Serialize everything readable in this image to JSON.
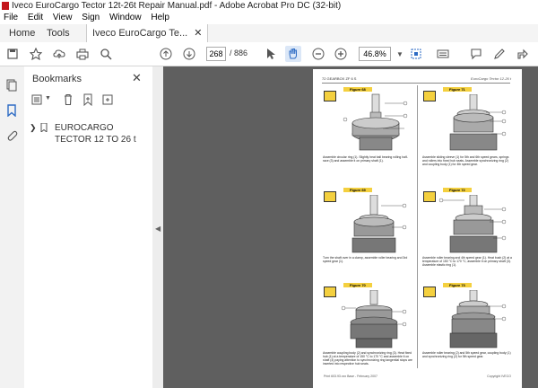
{
  "window": {
    "title": "Iveco EuroCargo Tector 12t-26t Repair Manual.pdf - Adobe Acrobat Pro DC (32-bit)"
  },
  "menu": [
    "File",
    "Edit",
    "View",
    "Sign",
    "Window",
    "Help"
  ],
  "tabs": {
    "home": "Home",
    "tools": "Tools",
    "document": "Iveco EuroCargo Te..."
  },
  "toolbar": {
    "page_current": "268",
    "page_total": "/ 886",
    "zoom": "46.8%"
  },
  "bookmarks": {
    "title": "Bookmarks",
    "item": "EUROCARGO TECTOR 12 TO 26 t"
  },
  "page": {
    "header_left": "72   GEARBOX  ZF 6 S",
    "header_right": "EuroCargo Tector 12-26 t",
    "footer_left": "Print 603.93.xxx   Base - February 2007",
    "footer_right": "Copyright IVECO",
    "figures": [
      {
        "label": "Figure 68",
        "caption": "Assemble circular ring (1). Slightly heat ball bearing rolling half-race (3) and assemble it on primary shaft (1)."
      },
      {
        "label": "Figure 71",
        "caption": "Assemble sliding sleeve (1) for 5th and 6th speed gears, springs and rollers into fixed hub seats. Assemble synchronizing ring (2) and coupling body (1) for 4th speed gear."
      },
      {
        "label": "Figure 69",
        "caption": "Turn the shaft over in a clamp, assemble roller bearing and 3rd speed gear (1)."
      },
      {
        "label": "Figure 72",
        "caption": "Assemble roller bearing and 4th speed gear (1). Heat bush (2) at a temperature of 150 °C to 170 °C, assemble it on primary shaft (3). Assemble elastic ring (1)."
      },
      {
        "label": "Figure 70",
        "caption": "Assemble coupling body (2) and synchronizing ring (3). Heat fixed hub (1) at a temperature of 150 °C to 170 °C and assemble it on shaft (4) paying attention to synchronizing ring tangential stops are inserted into respective hub seats."
      },
      {
        "label": "Figure 73",
        "caption": "Assemble roller bearing (2) and 5th speed gear, coupling body (1) and synchronizing ring (2) for 5th speed gear."
      }
    ]
  },
  "colors": {
    "accent": "#c4161c",
    "figure_tag": "#f4d03f",
    "viewer_bg": "#5f5f5f"
  }
}
